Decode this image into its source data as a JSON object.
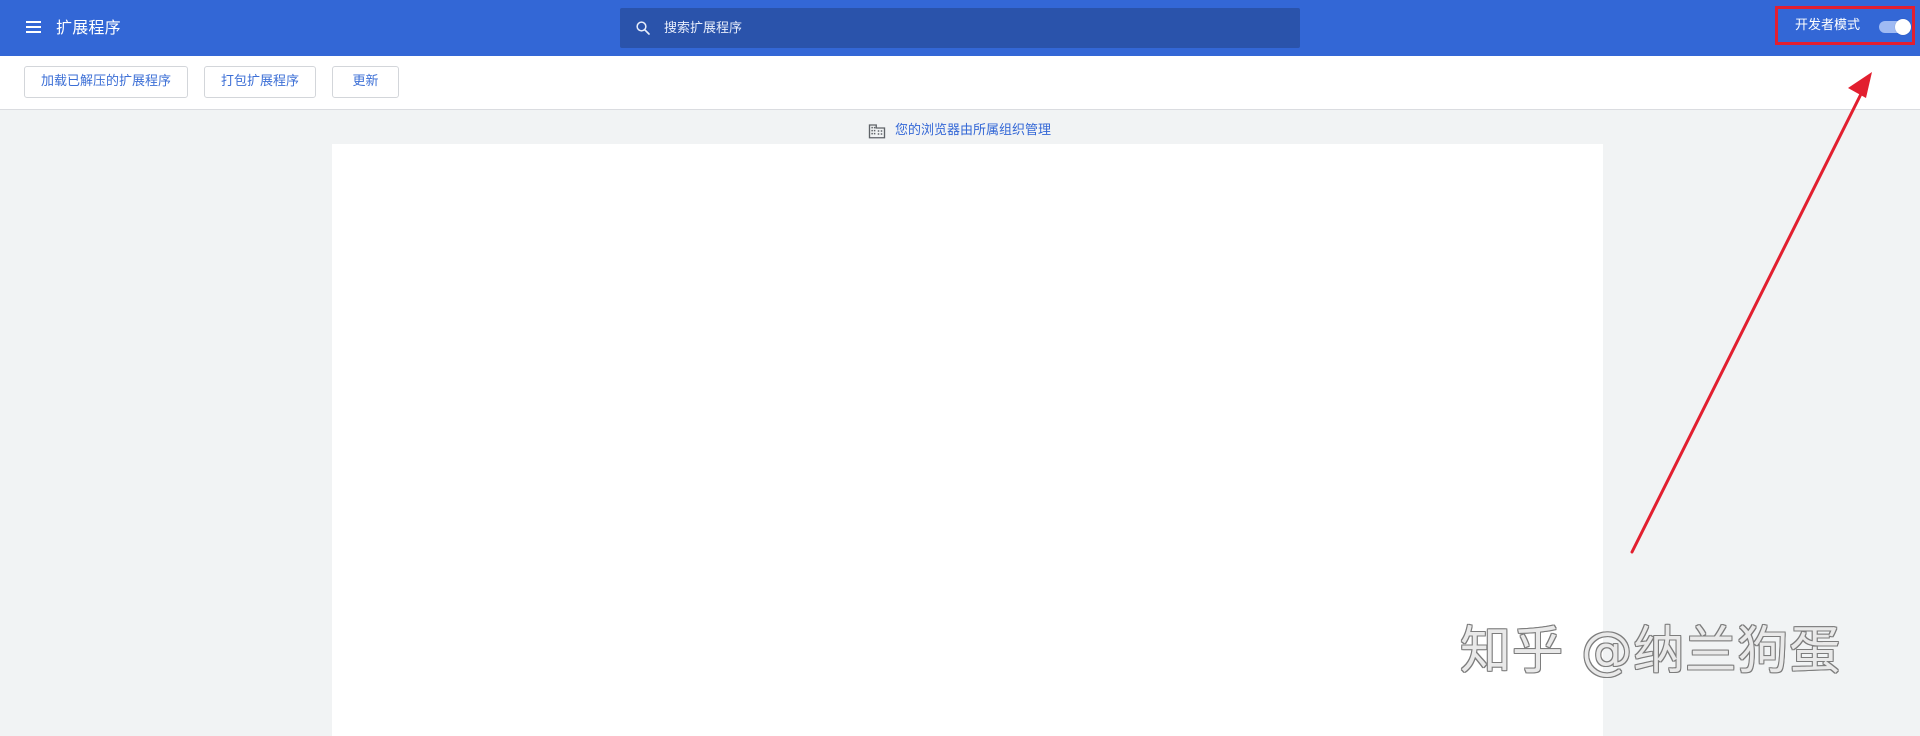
{
  "header": {
    "menu_icon": "hamburger-menu-icon",
    "title": "扩展程序",
    "search": {
      "icon": "search-icon",
      "placeholder": "搜索扩展程序",
      "value": ""
    },
    "developer_mode": {
      "label": "开发者模式",
      "enabled": true
    },
    "colors": {
      "header_background": "#3367d6",
      "search_background": "#2a53ab",
      "highlight_box": "#e21f2f"
    }
  },
  "toolbar": {
    "buttons": [
      {
        "label": "加载已解压的扩展程序"
      },
      {
        "label": "打包扩展程序"
      },
      {
        "label": "更新"
      }
    ]
  },
  "managed_notice": {
    "icon": "building-icon",
    "text": "您的浏览器由所属组织管理"
  },
  "content_panel": {
    "empty": true
  },
  "annotation": {
    "icon": "red-arrow-icon",
    "color": "#e21f2f"
  },
  "watermark": {
    "text": "知乎 @纳兰狗蛋"
  }
}
